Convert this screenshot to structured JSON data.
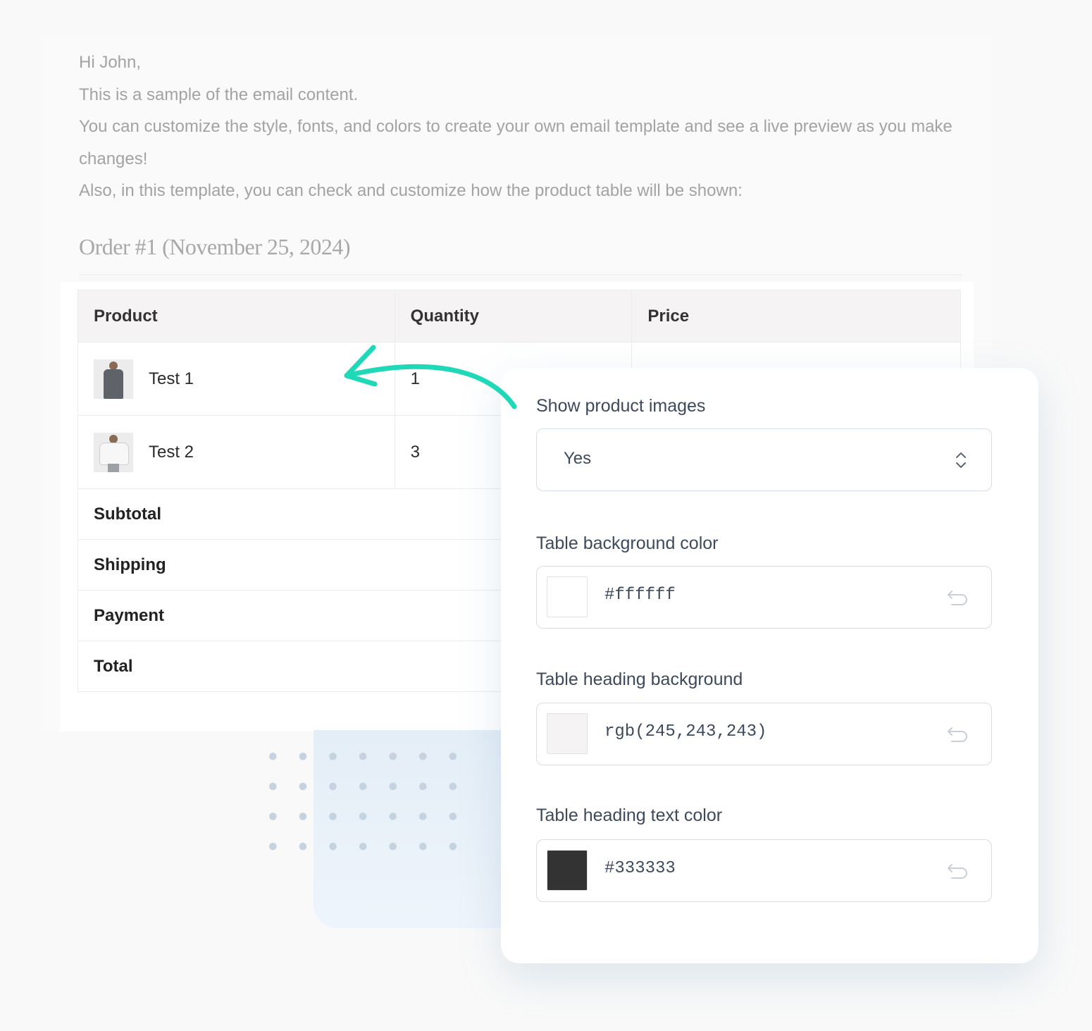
{
  "email": {
    "greeting": "Hi John,",
    "line1": "This is a sample of the email content.",
    "line2": "You can customize the style, fonts, and colors to create your own email template and see a live preview as you make changes!",
    "line3": "Also, in this template, you can check and customize how the product table will be shown:",
    "order_title": "Order #1 (November 25, 2024)"
  },
  "table": {
    "headers": [
      "Product",
      "Quantity",
      "Price"
    ],
    "items": [
      {
        "name": "Test 1",
        "quantity": "1"
      },
      {
        "name": "Test 2",
        "quantity": "3"
      }
    ],
    "totals": [
      "Subtotal",
      "Shipping",
      "Payment",
      "Total"
    ]
  },
  "settings": {
    "show_images": {
      "label": "Show product images",
      "value": "Yes"
    },
    "table_bg": {
      "label": "Table background color",
      "value": "#ffffff",
      "swatch": "#ffffff"
    },
    "heading_bg": {
      "label": "Table heading background",
      "value": "rgb(245,243,243)",
      "swatch": "#f5f3f3"
    },
    "heading_text": {
      "label": "Table heading text color",
      "value": "#333333",
      "swatch": "#333333"
    }
  },
  "colors": {
    "accent_arrow": "#1ed8b8"
  }
}
